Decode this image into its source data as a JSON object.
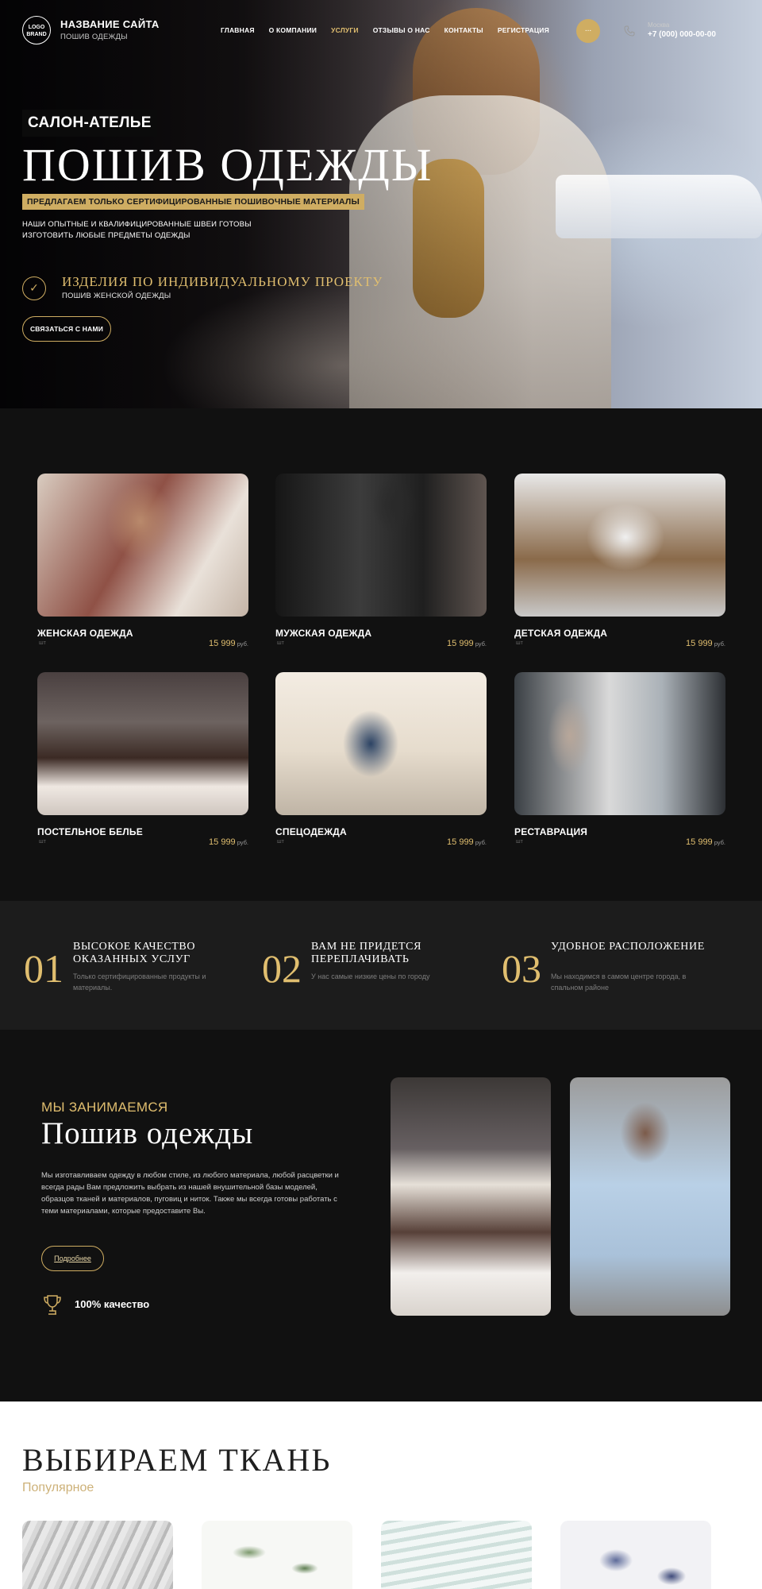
{
  "header": {
    "logo_line1": "LOGO",
    "logo_line2": "BRAND",
    "site_name": "НАЗВАНИЕ САЙТА",
    "site_sub": "ПОШИВ ОДЕЖДЫ",
    "nav": [
      "ГЛАВНАЯ",
      "О КОМПАНИИ",
      "УСЛУГИ",
      "ОТЗЫВЫ О НАС",
      "КОНТАКТЫ",
      "РЕГИСТРАЦИЯ"
    ],
    "nav_active_index": 2,
    "dot_label": "...",
    "city": "Москва",
    "phone": "+7 (000) 000-00-00"
  },
  "hero": {
    "tag": "САЛОН-АТЕЛЬЕ",
    "title": "ПОШИВ ОДЕЖДЫ",
    "gold_line": "ПРЕДЛАГАЕМ ТОЛЬКО СЕРТИФИЦИРОВАННЫЕ ПОШИВОЧНЫЕ МАТЕРИАЛЫ",
    "desc": "НАШИ ОПЫТНЫЕ И КВАЛИФИЦИРОВАННЫЕ ШВЕИ ГОТОВЫ ИЗГОТОВИТЬ ЛЮБЫЕ ПРЕДМЕТЫ ОДЕЖДЫ",
    "project_title": "ИЗДЕЛИЯ ПО ИНДИВИДУАЛЬНОМУ ПРОЕКТУ",
    "project_sub": "ПОШИВ ЖЕНСКОЙ ОДЕЖДЫ",
    "button": "СВЯЗАТЬСЯ С НАМИ"
  },
  "services": {
    "items": [
      {
        "name": "ЖЕНСКАЯ ОДЕЖДА",
        "unit": "шт",
        "price": "15 999",
        "currency": "руб."
      },
      {
        "name": "МУЖСКАЯ ОДЕЖДА",
        "unit": "шт",
        "price": "15 999",
        "currency": "руб."
      },
      {
        "name": "ДЕТСКАЯ ОДЕЖДА",
        "unit": "шт",
        "price": "15 999",
        "currency": "руб."
      },
      {
        "name": "ПОСТЕЛЬНОЕ БЕЛЬЕ",
        "unit": "шт",
        "price": "15 999",
        "currency": "руб."
      },
      {
        "name": "СПЕЦОДЕЖДА",
        "unit": "шт",
        "price": "15 999",
        "currency": "руб."
      },
      {
        "name": "РЕСТАВРАЦИЯ",
        "unit": "шт",
        "price": "15 999",
        "currency": "руб."
      }
    ]
  },
  "benefits": [
    {
      "num": "01",
      "title": "ВЫСОКОЕ КАЧЕСТВО ОКАЗАННЫХ УСЛУГ",
      "desc": "Только сертифицированные продукты и материалы."
    },
    {
      "num": "02",
      "title": "ВАМ НЕ ПРИДЕТСЯ ПЕРЕПЛАЧИВАТЬ",
      "desc": "У нас самые низкие цены по городу"
    },
    {
      "num": "03",
      "title": "УДОБНОЕ РАСПОЛОЖЕНИЕ",
      "desc": "Мы находимся в самом центре города, в спальном районе"
    }
  ],
  "about": {
    "kicker": "МЫ ЗАНИМАЕМСЯ",
    "title": "Пошив одежды",
    "text": "Мы изготавливаем одежду в любом стиле, из любого материала, любой расцветки и всегда рады Вам предложить выбрать из нашей внушительной базы моделей, образцов тканей и материалов, пуговиц и ниток. Также мы всегда готовы работать с теми материалами, которые предоставите Вы.",
    "button": "Подробнее",
    "quality": "100% качество"
  },
  "fabric": {
    "title": "ВЫБИРАЕМ ТКАНЬ",
    "subtitle": "Популярное"
  },
  "colors": {
    "accent_gold": "#cfad62",
    "background_dark": "#121212",
    "benefit_band": "#1c1c1c"
  },
  "icons": [
    "phone-icon",
    "check-badge-icon",
    "trophy-icon"
  ]
}
